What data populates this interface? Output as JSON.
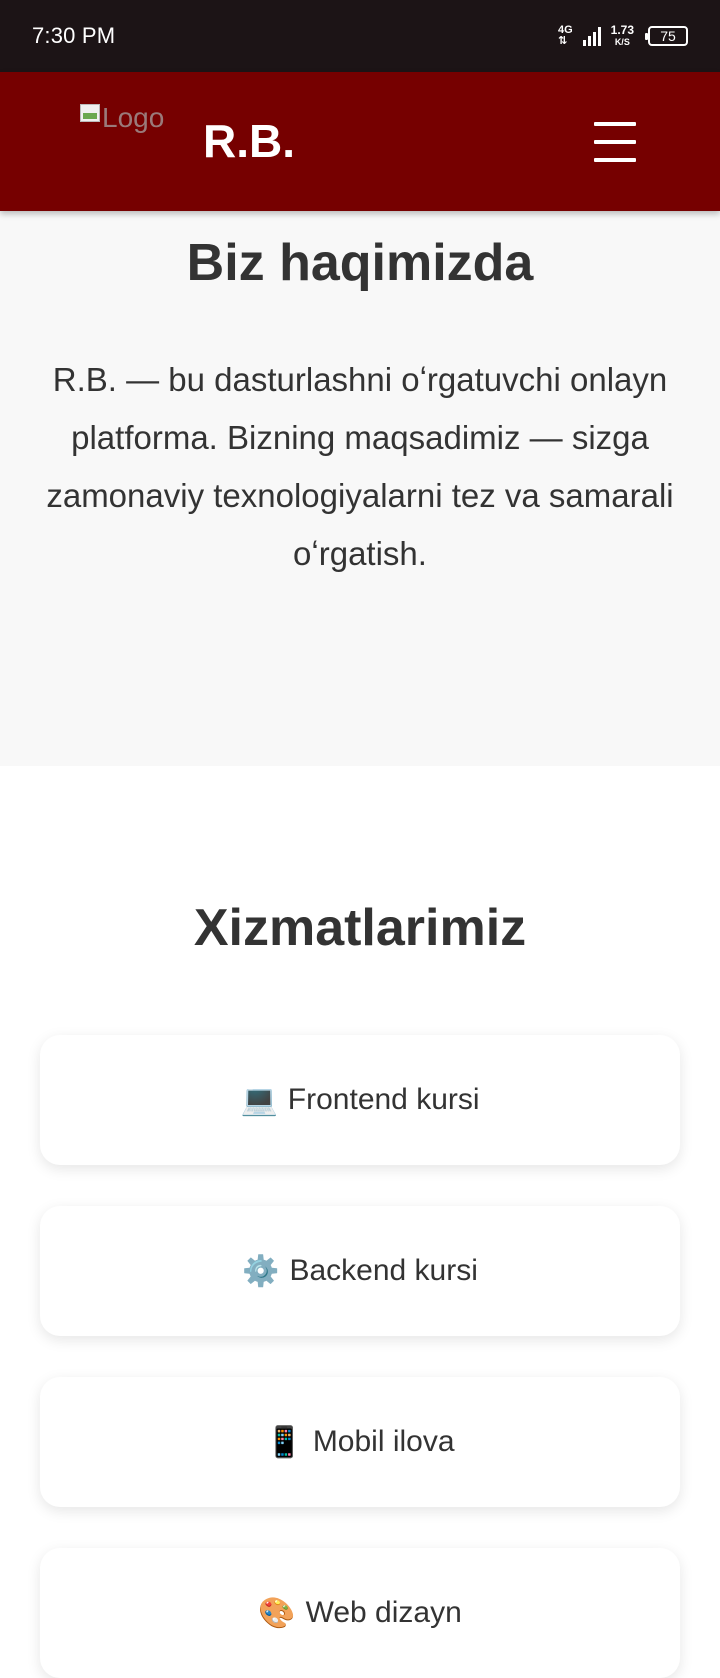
{
  "status_bar": {
    "time": "7:30 PM",
    "network": "4G",
    "speed_value": "1.73",
    "speed_unit": "K/S",
    "battery": "75"
  },
  "header": {
    "logo_alt": "Logo",
    "brand": "R.B."
  },
  "about": {
    "title": "Biz haqimizda",
    "text": "R.B. — bu dasturlashni oʻrgatuvchi onlayn platforma. Bizning maqsadimiz — sizga zamonaviy texnologiyalarni tez va samarali oʻrgatish."
  },
  "services": {
    "title": "Xizmatlarimiz",
    "items": [
      {
        "icon": "💻",
        "icon_name": "laptop-icon",
        "label": "Frontend kursi"
      },
      {
        "icon": "⚙️",
        "icon_name": "gear-icon",
        "label": "Backend kursi"
      },
      {
        "icon": "📱",
        "icon_name": "mobile-phone-icon",
        "label": "Mobil ilova"
      },
      {
        "icon": "🎨",
        "icon_name": "palette-icon",
        "label": "Web dizayn"
      }
    ]
  },
  "colors": {
    "header_bg": "#760000",
    "status_bg": "#1c1416",
    "section_bg": "#f8f8f8"
  }
}
